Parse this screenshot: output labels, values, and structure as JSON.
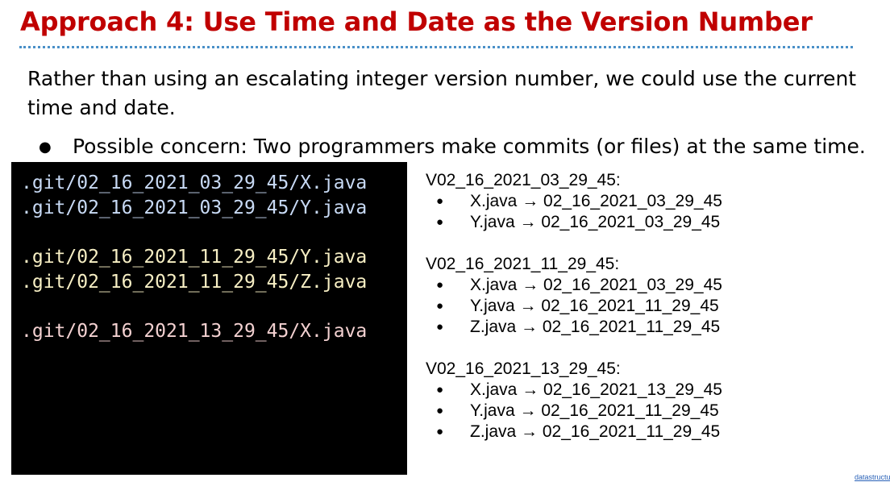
{
  "slide": {
    "title": "Approach 4: Use Time and Date as the Version Number",
    "intro": "Rather than using an escalating integer version number, we could use the current time and date.",
    "bullet_symbol": "●",
    "bullet": "Possible concern: Two programmers make commits (or files) at the same time."
  },
  "terminal": {
    "lines": [
      {
        "text": ".git/02_16_2021_03_29_45/X.java",
        "color": "#c8daf5"
      },
      {
        "text": ".git/02_16_2021_03_29_45/Y.java",
        "color": "#c8daf5"
      },
      {
        "text": ".git/02_16_2021_11_29_45/Y.java",
        "color": "#f7efc4"
      },
      {
        "text": ".git/02_16_2021_11_29_45/Z.java",
        "color": "#f7efc4"
      },
      {
        "text": ".git/02_16_2021_13_29_45/X.java",
        "color": "#f3d1d1"
      }
    ]
  },
  "versions": [
    {
      "name": "V02_16_2021_03_29_45:",
      "items": [
        "X.java → 02_16_2021_03_29_45",
        "Y.java → 02_16_2021_03_29_45"
      ]
    },
    {
      "name": "V02_16_2021_11_29_45:",
      "items": [
        "X.java → 02_16_2021_03_29_45",
        "Y.java → 02_16_2021_11_29_45",
        "Z.java → 02_16_2021_11_29_45"
      ]
    },
    {
      "name": "V02_16_2021_13_29_45:",
      "items": [
        "X.java → 02_16_2021_13_29_45",
        "Y.java → 02_16_2021_11_29_45",
        "Z.java → 02_16_2021_11_29_45"
      ]
    }
  ],
  "footer": {
    "link": "datastructu"
  },
  "colors": {
    "title": "#c00000",
    "rule": "#4a90c8",
    "terminal_bg": "#000000"
  }
}
